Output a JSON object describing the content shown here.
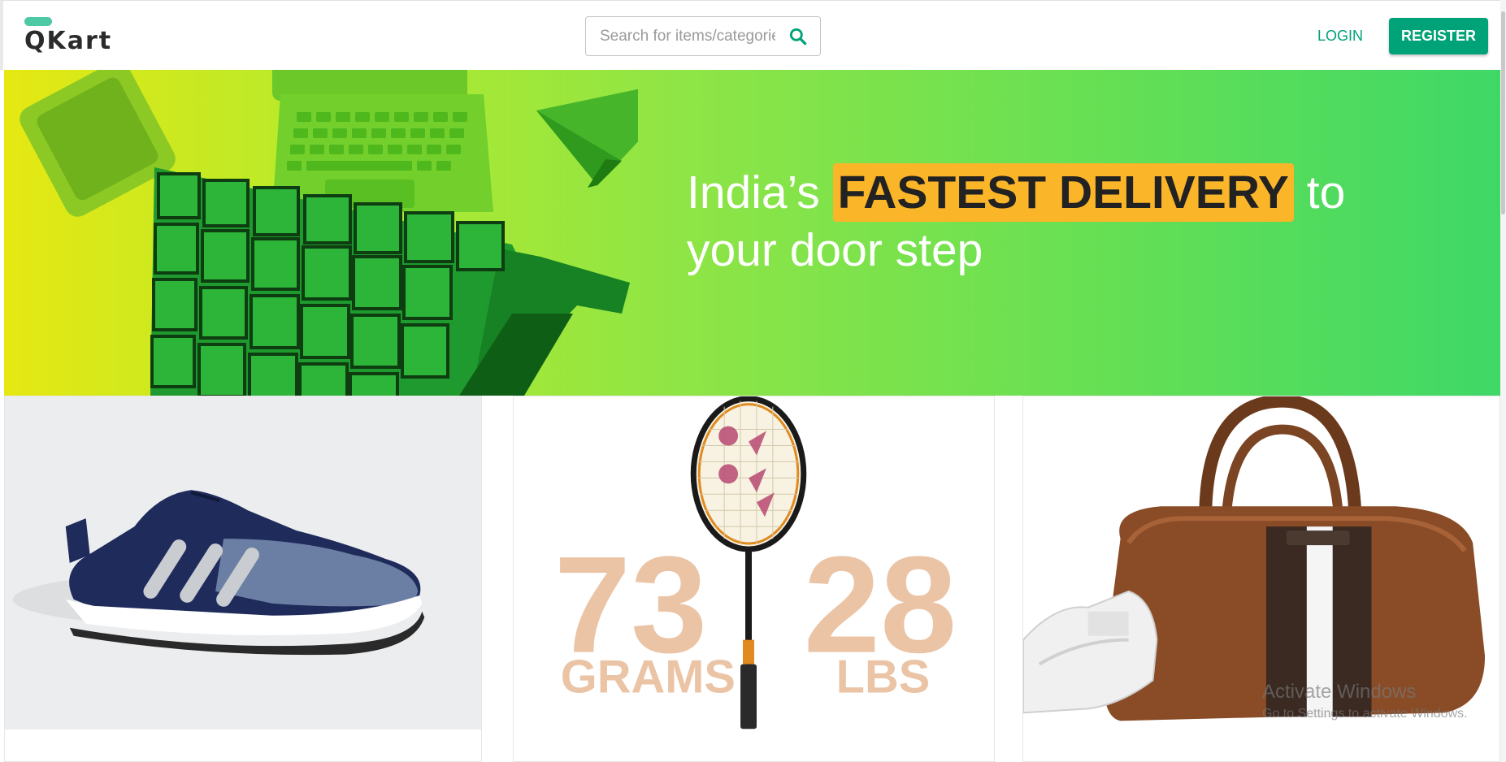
{
  "brand": {
    "name": "QKart"
  },
  "search": {
    "placeholder": "Search for items/categories"
  },
  "header": {
    "login_label": "LOGIN",
    "register_label": "REGISTER"
  },
  "hero": {
    "prefix": "India’s ",
    "highlight": "FASTEST DELIVERY",
    "suffix": " to",
    "line2": "your door step"
  },
  "products": [
    {
      "image": "sports-shoe-image"
    },
    {
      "image": "badminton-racket-image",
      "stats": [
        "73",
        "GRAMS",
        "28",
        "LBS"
      ]
    },
    {
      "image": "leather-duffel-bag-image"
    }
  ],
  "watermark": {
    "title": "Activate Windows",
    "subtitle": "Go to Settings to activate Windows."
  },
  "colors": {
    "primary": "#00a278",
    "highlight": "#fbb528",
    "logo_accent": "#4dc9a5"
  }
}
